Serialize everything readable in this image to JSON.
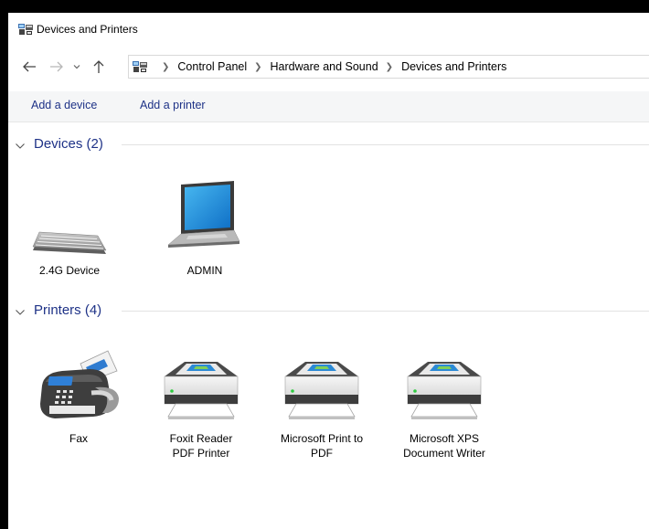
{
  "window": {
    "title": "Devices and Printers"
  },
  "address": {
    "breadcrumbs": [
      "Control Panel",
      "Hardware and Sound",
      "Devices and Printers"
    ]
  },
  "commands": {
    "add_device": "Add a device",
    "add_printer": "Add a printer"
  },
  "groups": {
    "devices": {
      "title": "Devices (2)",
      "items": [
        {
          "label": "2.4G Device",
          "icon": "keyboard-icon"
        },
        {
          "label": "ADMIN",
          "icon": "laptop-icon"
        }
      ]
    },
    "printers": {
      "title": "Printers (4)",
      "items": [
        {
          "label": "Fax",
          "icon": "fax-icon"
        },
        {
          "label": "Foxit Reader PDF Printer",
          "icon": "printer-icon"
        },
        {
          "label": "Microsoft Print to PDF",
          "icon": "printer-icon"
        },
        {
          "label": "Microsoft XPS Document Writer",
          "icon": "printer-icon"
        }
      ]
    }
  },
  "colors": {
    "link_blue": "#1e3287",
    "frame": "#000000",
    "command_bar_bg": "#f5f6f7"
  }
}
